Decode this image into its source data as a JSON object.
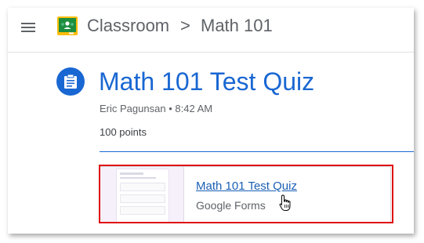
{
  "header": {
    "app_name": "Classroom",
    "separator": ">",
    "course": "Math 101"
  },
  "assignment": {
    "title": "Math 101 Test Quiz",
    "author": "Eric Pagunsan",
    "bullet": "•",
    "time": "8:42 AM",
    "points": "100 points"
  },
  "attachment": {
    "title": "Math 101 Test Quiz",
    "type": "Google Forms"
  },
  "colors": {
    "accent": "#1967d2",
    "highlight": "#e01010",
    "logo_green": "#1e8e3e",
    "logo_yellow": "#fbbc04"
  },
  "icons": {
    "menu": "hamburger-menu-icon",
    "logo": "google-classroom-logo",
    "assignment": "assignment-icon",
    "cursor": "hand-pointer-cursor"
  }
}
